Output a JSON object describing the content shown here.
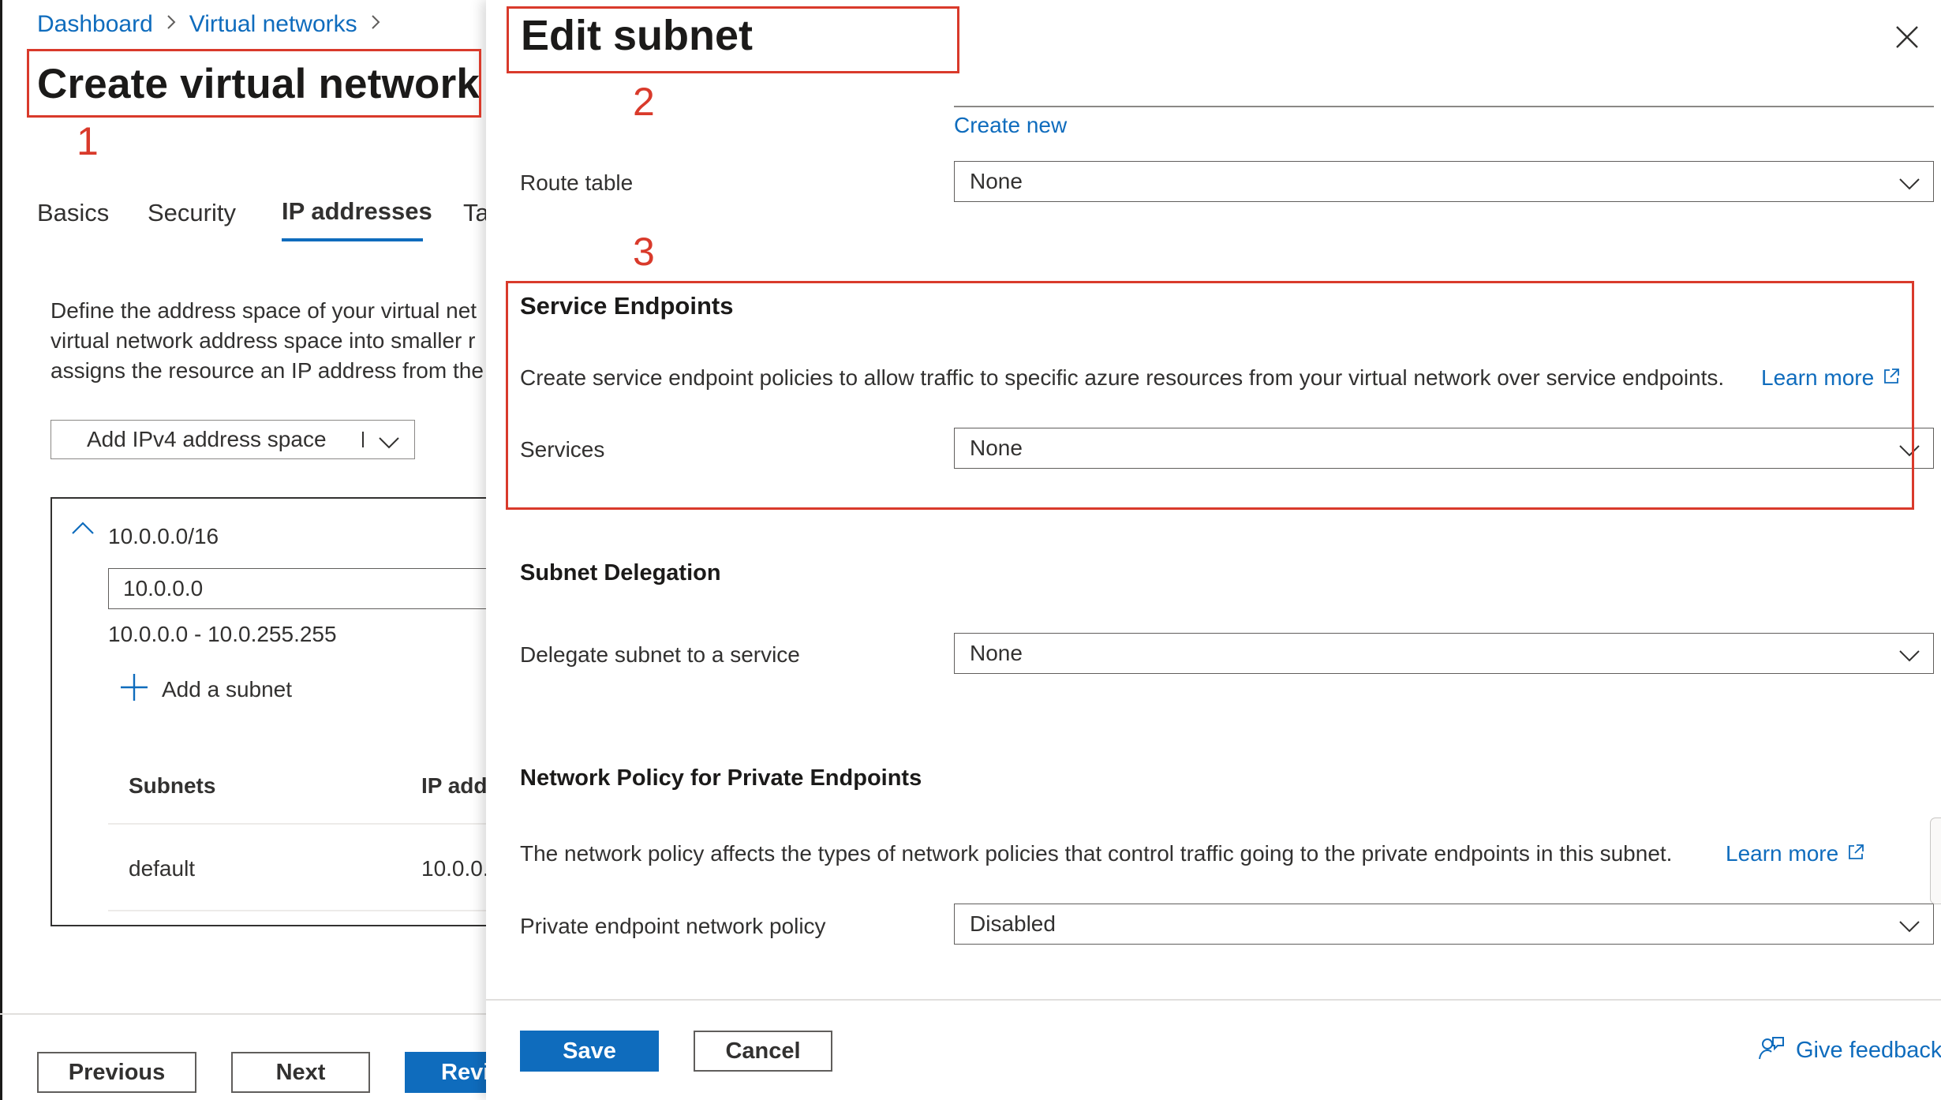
{
  "breadcrumb": {
    "items": [
      "Dashboard",
      "Virtual networks"
    ],
    "separator": ">"
  },
  "page": {
    "title": "Create virtual network"
  },
  "tabs": [
    "Basics",
    "Security",
    "IP addresses",
    "Ta"
  ],
  "intro": {
    "lines": [
      "Define the address space of your virtual net",
      "virtual network address space into smaller r",
      "assigns the resource an IP address from the"
    ]
  },
  "address_space": {
    "add_button_label": "Add IPv4 address space",
    "cidr": "10.0.0.0/16",
    "address_value": "10.0.0.0",
    "range": "10.0.0.0 - 10.0.255.255",
    "add_subnet_label": "Add a subnet",
    "columns": [
      "Subnets",
      "IP add"
    ],
    "rows": [
      {
        "name": "default",
        "ip": "10.0.0."
      }
    ]
  },
  "left_footer": {
    "previous": "Previous",
    "next": "Next",
    "review": "Revi"
  },
  "panel": {
    "title": "Edit subnet",
    "create_new": "Create new",
    "route_table": {
      "label": "Route table",
      "value": "None"
    },
    "service_endpoints": {
      "heading": "Service Endpoints",
      "description": "Create service endpoint policies to allow traffic to specific azure resources from your virtual network over service endpoints.",
      "learn_more": "Learn more",
      "services_label": "Services",
      "services_value": "None"
    },
    "delegation": {
      "heading": "Subnet Delegation",
      "label": "Delegate subnet to a service",
      "value": "None"
    },
    "network_policy": {
      "heading": "Network Policy for Private Endpoints",
      "description": "The network policy affects the types of network policies that control traffic going to the private endpoints in this subnet.",
      "learn_more": "Learn more",
      "label": "Private endpoint network policy",
      "value": "Disabled"
    },
    "save": "Save",
    "cancel": "Cancel",
    "feedback": "Give feedback"
  },
  "annotations": [
    "1",
    "2",
    "3"
  ],
  "colors": {
    "accent": "#0f6cbd",
    "annotation": "#d93a2b",
    "text": "#323130"
  }
}
